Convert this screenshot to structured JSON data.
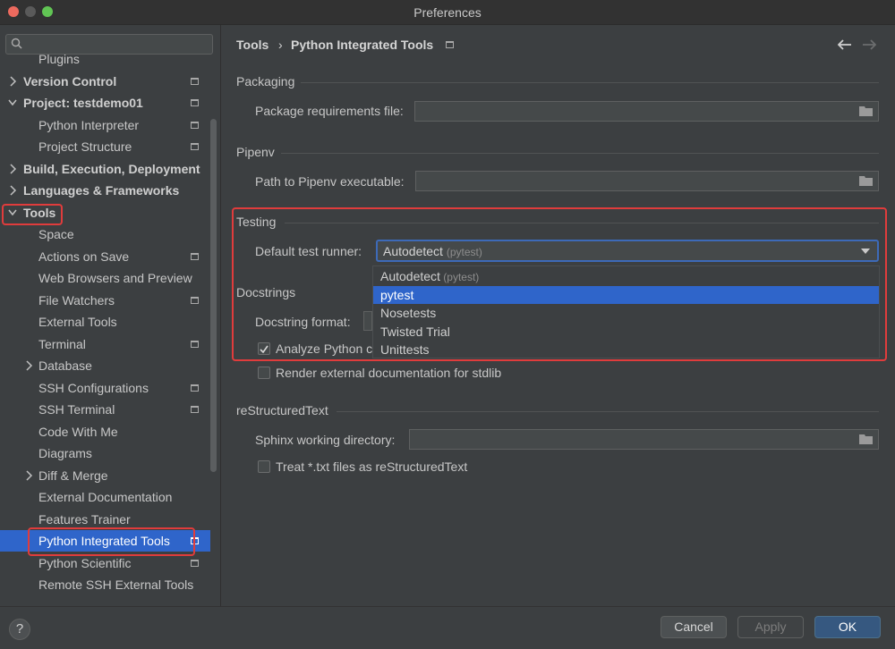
{
  "window": {
    "title": "Preferences"
  },
  "search": {
    "placeholder": ""
  },
  "sidebar": {
    "items": [
      {
        "label": "Plugins",
        "bold": false,
        "chev": "",
        "page": false
      },
      {
        "label": "Version Control",
        "bold": true,
        "chev": "right",
        "page": true
      },
      {
        "label": "Project: testdemo01",
        "bold": true,
        "chev": "down",
        "page": true
      },
      {
        "label": "Python Interpreter",
        "bold": false,
        "chev": "",
        "page": true
      },
      {
        "label": "Project Structure",
        "bold": false,
        "chev": "",
        "page": true
      },
      {
        "label": "Build, Execution, Deployment",
        "bold": true,
        "chev": "right",
        "page": false
      },
      {
        "label": "Languages & Frameworks",
        "bold": true,
        "chev": "right",
        "page": false
      },
      {
        "label": "Tools",
        "bold": true,
        "chev": "down",
        "page": false
      },
      {
        "label": "Space",
        "bold": false,
        "chev": "",
        "page": false
      },
      {
        "label": "Actions on Save",
        "bold": false,
        "chev": "",
        "page": true
      },
      {
        "label": "Web Browsers and Preview",
        "bold": false,
        "chev": "",
        "page": false
      },
      {
        "label": "File Watchers",
        "bold": false,
        "chev": "",
        "page": true
      },
      {
        "label": "External Tools",
        "bold": false,
        "chev": "",
        "page": false
      },
      {
        "label": "Terminal",
        "bold": false,
        "chev": "",
        "page": true
      },
      {
        "label": "Database",
        "bold": false,
        "chev": "right",
        "page": false
      },
      {
        "label": "SSH Configurations",
        "bold": false,
        "chev": "",
        "page": true
      },
      {
        "label": "SSH Terminal",
        "bold": false,
        "chev": "",
        "page": true
      },
      {
        "label": "Code With Me",
        "bold": false,
        "chev": "",
        "page": false
      },
      {
        "label": "Diagrams",
        "bold": false,
        "chev": "",
        "page": false
      },
      {
        "label": "Diff & Merge",
        "bold": false,
        "chev": "right",
        "page": false
      },
      {
        "label": "External Documentation",
        "bold": false,
        "chev": "",
        "page": false
      },
      {
        "label": "Features Trainer",
        "bold": false,
        "chev": "",
        "page": false
      },
      {
        "label": "Python Integrated Tools",
        "bold": false,
        "chev": "",
        "page": true,
        "selected": true
      },
      {
        "label": "Python Scientific",
        "bold": false,
        "chev": "",
        "page": true
      },
      {
        "label": "Remote SSH External Tools",
        "bold": false,
        "chev": "",
        "page": false
      }
    ]
  },
  "breadcrumb": {
    "parent": "Tools",
    "current": "Python Integrated Tools"
  },
  "packaging": {
    "title": "Packaging",
    "req_label": "Package requirements file:",
    "req_value": ""
  },
  "pipenv": {
    "title": "Pipenv",
    "path_label": "Path to Pipenv executable:",
    "path_value": ""
  },
  "testing": {
    "title": "Testing",
    "runner_label": "Default test runner:",
    "runner_value": "Autodetect",
    "runner_hint": "(pytest)",
    "options": [
      {
        "label": "Autodetect",
        "hint": "(pytest)"
      },
      {
        "label": "pytest",
        "hint": "",
        "selected": true
      },
      {
        "label": "Nosetests",
        "hint": ""
      },
      {
        "label": "Twisted Trial",
        "hint": ""
      },
      {
        "label": "Unittests",
        "hint": ""
      }
    ]
  },
  "docstrings": {
    "title": "Docstrings",
    "format_label": "Docstring format:",
    "analyze_label": "Analyze Python c",
    "analyze_checked": true,
    "render_label": "Render external documentation for stdlib",
    "render_checked": false
  },
  "rest": {
    "title": "reStructuredText",
    "sphinx_label": "Sphinx working directory:",
    "sphinx_value": "",
    "txt_label": "Treat *.txt files as reStructuredText",
    "txt_checked": false
  },
  "footer": {
    "help": "?",
    "cancel": "Cancel",
    "apply": "Apply",
    "ok": "OK"
  },
  "colors": {
    "accent": "#2f65ca",
    "highlight": "#e03c3c"
  }
}
